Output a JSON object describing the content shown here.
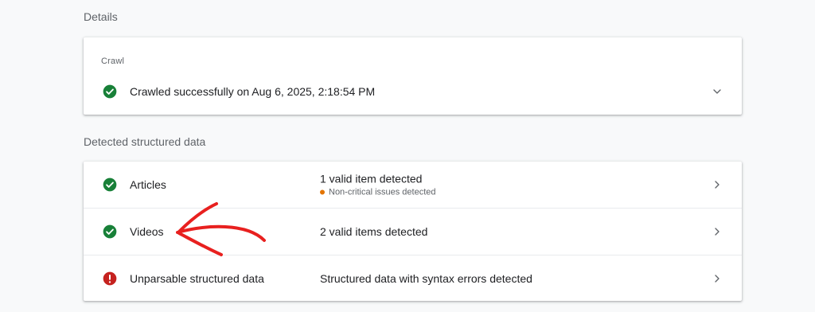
{
  "details": {
    "heading": "Details",
    "crawl": {
      "label": "Crawl",
      "status_text": "Crawled successfully on Aug 6, 2025, 2:18:54 PM",
      "icon": "check-circle-icon",
      "expand_icon": "chevron-down-icon"
    }
  },
  "structured_data": {
    "heading": "Detected structured data",
    "items": [
      {
        "label": "Articles",
        "status": "1 valid item detected",
        "sub_status": "Non-critical issues detected",
        "icon": "check-circle-icon",
        "state": "valid"
      },
      {
        "label": "Videos",
        "status": "2 valid items detected",
        "icon": "check-circle-icon",
        "state": "valid"
      },
      {
        "label": "Unparsable structured data",
        "status": "Structured data with syntax errors detected",
        "icon": "error-circle-icon",
        "state": "error"
      }
    ]
  },
  "colors": {
    "valid": "#188038",
    "error": "#c5221f",
    "warning": "#e37400",
    "annotation": "#e8201f"
  }
}
